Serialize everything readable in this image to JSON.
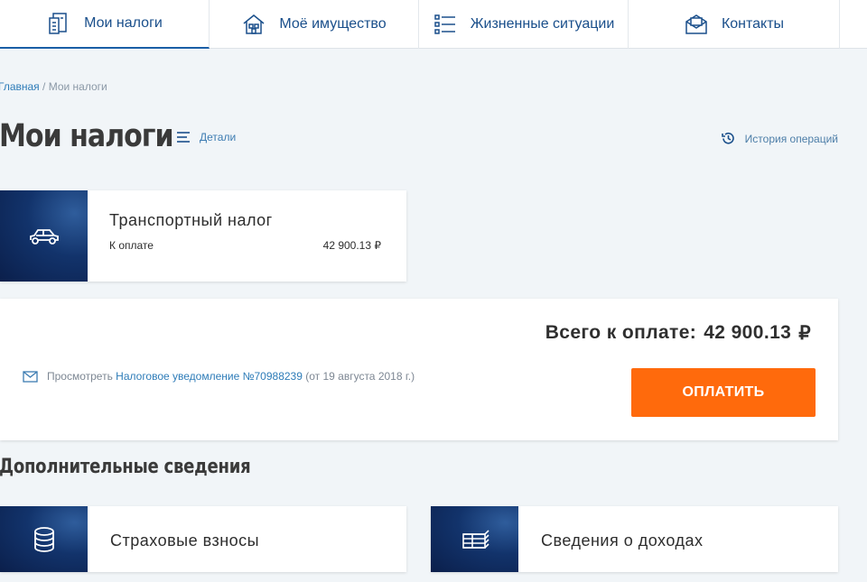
{
  "nav": {
    "tabs": [
      {
        "label": "Мои налоги",
        "icon": "tax-document-icon",
        "active": true
      },
      {
        "label": "Моё имущество",
        "icon": "house-icon",
        "active": false
      },
      {
        "label": "Жизненные ситуации",
        "icon": "list-icon",
        "active": false
      },
      {
        "label": "Контакты",
        "icon": "envelope-icon",
        "active": false
      }
    ]
  },
  "breadcrumb": {
    "home": "Главная",
    "separator": " / ",
    "current": "Мои налоги"
  },
  "header": {
    "title": "Мои налоги",
    "details_label": "Детали",
    "history_label": "История операций"
  },
  "tax_card": {
    "icon": "car-icon",
    "name": "Транспортный налог",
    "due_label": "К оплате",
    "due_amount": "42 900.13 ₽"
  },
  "summary": {
    "total_label": "Всего к оплате:",
    "total_amount": "42 900.13",
    "currency": "₽",
    "notice_prefix": "Просмотреть",
    "notice_link": "Налоговое уведомление №70988239",
    "notice_suffix": "(от 19 августа 2018 г.)",
    "pay_button": "ОПЛАТИТЬ"
  },
  "additional": {
    "title": "Дополнительные сведения",
    "cards": [
      {
        "label": "Страховые взносы",
        "icon": "coins-icon"
      },
      {
        "label": "Сведения о доходах",
        "icon": "money-stack-icon"
      }
    ]
  },
  "colors": {
    "accent": "#1a5fa6",
    "pay": "#ff6a0c",
    "background": "#f1f5f8"
  }
}
